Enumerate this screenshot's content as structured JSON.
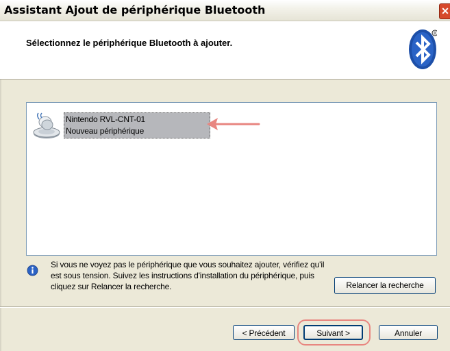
{
  "window": {
    "title": "Assistant Ajout de périphérique Bluetooth",
    "close_symbol": "✕"
  },
  "header": {
    "title": "Sélectionnez le périphérique Bluetooth à ajouter.",
    "logo_icon": "bluetooth-icon"
  },
  "device_list": {
    "items": [
      {
        "name": "Nintendo RVL-CNT-01",
        "status": "Nouveau périphérique",
        "icon": "bluetooth-device-icon",
        "selected": true
      }
    ]
  },
  "info": {
    "icon": "info-icon",
    "text": "Si vous ne voyez pas le périphérique que vous souhaitez ajouter, vérifiez qu'il est sous tension. Suivez les instructions d'installation du périphérique, puis cliquez sur Relancer la recherche."
  },
  "buttons": {
    "search_again": "Relancer la recherche",
    "back": "< Précédent",
    "next": "Suivant >",
    "cancel": "Annuler"
  },
  "colors": {
    "annotation": "#e88680",
    "bluetooth": "#1d4fa8",
    "selection": "#b6b7bb"
  }
}
